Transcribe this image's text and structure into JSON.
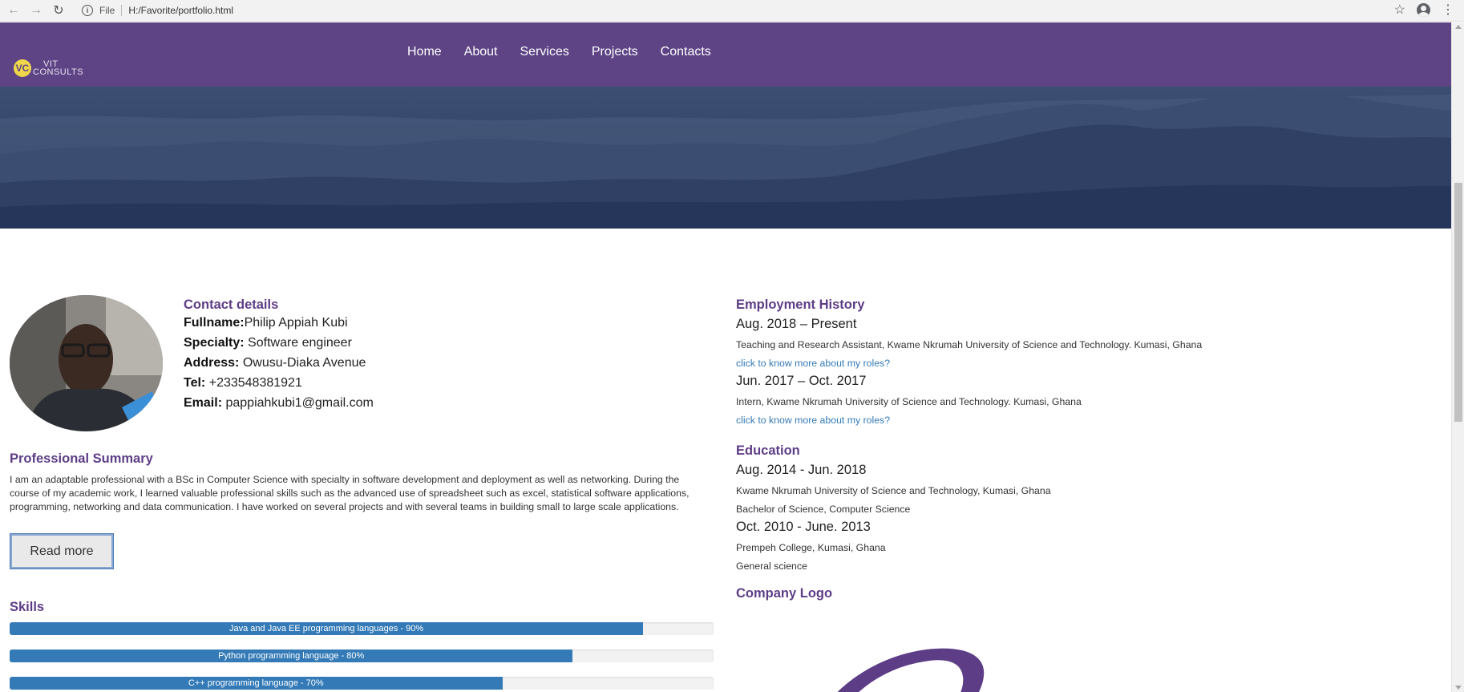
{
  "browser": {
    "scheme_label": "File",
    "url": "H:/Favorite/portfolio.html"
  },
  "site": {
    "logo": {
      "mark": "VC",
      "line1": "VIT",
      "line2": "CONSULTS"
    },
    "nav": [
      "Home",
      "About",
      "Services",
      "Projects",
      "Contacts"
    ]
  },
  "contact": {
    "title": "Contact details",
    "fullname_label": "Fullname:",
    "fullname": "Philip Appiah Kubi",
    "specialty_label": "Specialty:",
    "specialty": "Software engineer",
    "address_label": "Address:",
    "address": "Owusu-Diaka Avenue",
    "tel_label": "Tel:",
    "tel": "+233548381921",
    "email_label": "Email:",
    "email": "pappiahkubi1@gmail.com"
  },
  "summary": {
    "title": "Professional Summary",
    "text": "I am an adaptable professional with a BSc in Computer Science with specialty in software development and deployment as well as networking. During the course of my academic work, I learned valuable professional skills such as the advanced use of spreadsheet such as excel, statistical software applications, programming, networking and data communication. I have worked on several projects and with several teams in building small to large scale applications.",
    "button": "Read more"
  },
  "skills": {
    "title": "Skills",
    "items": [
      {
        "label": "Java and Java EE programming languages - 90%",
        "percent": 90
      },
      {
        "label": "Python programming language - 80%",
        "percent": 80
      },
      {
        "label": "C++ programming language - 70%",
        "percent": 70
      }
    ]
  },
  "employment": {
    "title": "Employment History",
    "entries": [
      {
        "period": "Aug. 2018 – Present",
        "role": "Teaching and Research Assistant, Kwame Nkrumah University of Science and Technology. Kumasi, Ghana",
        "link": "click to know more about my roles?"
      },
      {
        "period": "Jun. 2017 – Oct. 2017",
        "role": "Intern, Kwame Nkrumah University of Science and Technology. Kumasi, Ghana",
        "link": "click to know more about my roles?"
      }
    ]
  },
  "education": {
    "title": "Education",
    "entries": [
      {
        "period": "Aug. 2014 - Jun. 2018",
        "school": "Kwame Nkrumah University of Science and Technology, Kumasi, Ghana",
        "program": "Bachelor of Science, Computer Science"
      },
      {
        "period": "Oct. 2010 - June. 2013",
        "school": "Prempeh College, Kumasi, Ghana",
        "program": "General science"
      }
    ]
  },
  "company_logo": {
    "title": "Company Logo"
  },
  "colors": {
    "header": "#5e4485",
    "heading": "#5e3d87",
    "skill_fill": "#337ab7",
    "link": "#337ab7"
  }
}
